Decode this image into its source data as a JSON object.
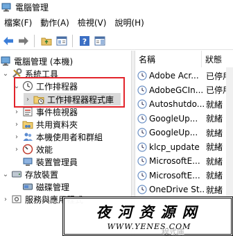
{
  "window": {
    "title": "電腦管理"
  },
  "menu": [
    "檔案(F)",
    "動作(A)",
    "檢視(V)",
    "說明(H)"
  ],
  "toolbar": {
    "buttons": [
      "back-arrow-icon",
      "forward-arrow-icon",
      "up-folder-icon",
      "show-tree-icon",
      "help-icon",
      "action-pane-icon"
    ]
  },
  "tree": {
    "root": "電腦管理 (本機)",
    "system_tools": "系統工具",
    "task_scheduler": "工作排程器",
    "task_scheduler_library": "工作排程器程式庫",
    "event_viewer": "事件檢視器",
    "shared_folders": "共用資料夾",
    "local_users": "本機使用者和群組",
    "performance": "效能",
    "device_manager": "裝置管理員",
    "storage": "存放裝置",
    "disk_management": "磁碟管理",
    "services_apps": "服務與應用程式"
  },
  "task_list": {
    "columns": {
      "name": "名稱",
      "status": "狀態"
    },
    "rows": [
      {
        "name": "Adobe Acr...",
        "status": "已停用"
      },
      {
        "name": "AdobeGCIn...",
        "status": "已停用"
      },
      {
        "name": "Autoshutdo...",
        "status": "就緒"
      },
      {
        "name": "GoogleUp...",
        "status": "就緒"
      },
      {
        "name": "GoogleUp...",
        "status": "就緒"
      },
      {
        "name": "klcp_update",
        "status": "就緒"
      },
      {
        "name": "MicrosoftE...",
        "status": "就緒"
      },
      {
        "name": "MicrosoftE...",
        "status": "就緒"
      },
      {
        "name": "OneDrive St...",
        "status": "就緒"
      }
    ]
  },
  "watermark": {
    "main": "夜河资源网",
    "url": "WWW.YENES.COM",
    "ghost": "程式庫"
  },
  "colors": {
    "highlight": "#e2232a",
    "selected_bg": "#d9d9d9"
  }
}
